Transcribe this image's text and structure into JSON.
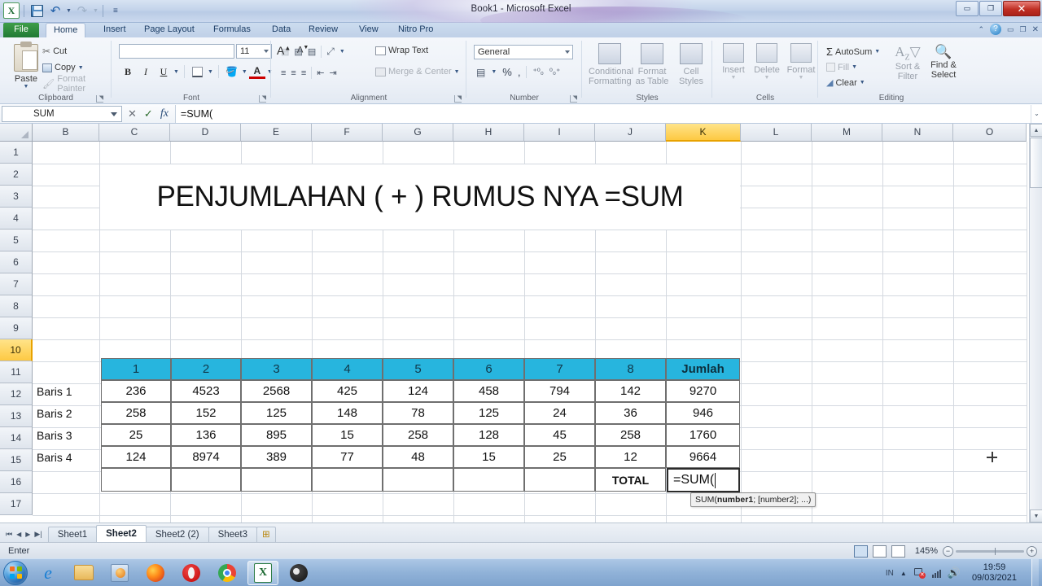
{
  "window": {
    "title": "Book1  -  Microsoft Excel",
    "minimize": "–",
    "maximize": "❐",
    "close": "✕"
  },
  "quick_access": {
    "excel_logo": "X",
    "save_tip": "Save",
    "undo": "↶",
    "redo": "↷",
    "customize": "≡"
  },
  "ribbon": {
    "tabs": [
      {
        "label": "File",
        "active": false,
        "file": true
      },
      {
        "label": "Home",
        "active": true
      },
      {
        "label": "Insert",
        "active": false
      },
      {
        "label": "Page Layout",
        "active": false
      },
      {
        "label": "Formulas",
        "active": false
      },
      {
        "label": "Data",
        "active": false
      },
      {
        "label": "Review",
        "active": false
      },
      {
        "label": "View",
        "active": false
      },
      {
        "label": "Nitro Pro",
        "active": false
      }
    ],
    "help_icons": {
      "minimize_ribbon": "⌃",
      "help": "?",
      "win_min": "–",
      "win_restore": "❐",
      "win_close": "✕"
    },
    "clipboard": {
      "label": "Clipboard",
      "paste": "Paste",
      "cut": "Cut",
      "copy": "Copy",
      "format_painter": "Format Painter"
    },
    "font": {
      "label": "Font",
      "font_name": "",
      "font_name_placeholder": "",
      "font_size": "11",
      "grow_font": "A",
      "shrink_font": "A",
      "bold": "B",
      "italic": "I",
      "underline": "U",
      "borders": "▦",
      "fill_color": "A",
      "font_color": "A"
    },
    "alignment": {
      "label": "Alignment",
      "wrap_text": "Wrap Text",
      "merge_center": "Merge & Center",
      "align_top": "≡",
      "align_middle": "≡",
      "align_bottom": "≡",
      "orientation": "⤨",
      "align_left": "≡",
      "align_center": "≡",
      "align_right": "≡",
      "decrease_indent": "⇤",
      "increase_indent": "⇥"
    },
    "number": {
      "label": "Number",
      "format": "General",
      "accounting": "¤",
      "percent": "%",
      "comma": ",",
      "increase_decimal": ".00",
      "decrease_decimal": ".0"
    },
    "styles": {
      "label": "Styles",
      "conditional_formatting": "Conditional\nFormatting",
      "conditional_formatting_l1": "Conditional",
      "conditional_formatting_l2": "Formatting",
      "format_as_table_l1": "Format",
      "format_as_table_l2": "as Table",
      "cell_styles_l1": "Cell",
      "cell_styles_l2": "Styles"
    },
    "cells": {
      "label": "Cells",
      "insert": "Insert",
      "delete": "Delete",
      "format": "Format"
    },
    "editing": {
      "label": "Editing",
      "autosum": "AutoSum",
      "autosum_sigma": "Σ",
      "fill": "Fill",
      "clear": "Clear",
      "sort_filter_l1": "Sort &",
      "sort_filter_l2": "Filter",
      "find_select_l1": "Find &",
      "find_select_l2": "Select"
    }
  },
  "formula_bar": {
    "name_box": "SUM",
    "cancel": "✕",
    "enter": "✓",
    "insert_function": "fx",
    "formula": "=SUM(",
    "expand": "⌄"
  },
  "grid": {
    "columns": [
      "B",
      "C",
      "D",
      "E",
      "F",
      "G",
      "H",
      "I",
      "J",
      "K",
      "L",
      "M",
      "N",
      "O"
    ],
    "selected_column": "K",
    "rows": [
      "1",
      "2",
      "3",
      "4",
      "5",
      "6",
      "7",
      "8",
      "9",
      "10",
      "11",
      "12",
      "13",
      "14",
      "15",
      "16",
      "17"
    ],
    "selected_row": "10",
    "sheet_title": "PENJUMLAHAN ( + ) RUMUS NYA =SUM",
    "table_header": [
      "1",
      "2",
      "3",
      "4",
      "5",
      "6",
      "7",
      "8",
      "Jumlah"
    ],
    "row_labels": [
      "Baris 1",
      "Baris 2",
      "Baris 3",
      "Baris 4"
    ],
    "data": [
      [
        "236",
        "4523",
        "2568",
        "425",
        "124",
        "458",
        "794",
        "142",
        "9270"
      ],
      [
        "258",
        "152",
        "125",
        "148",
        "78",
        "125",
        "24",
        "36",
        "946"
      ],
      [
        "25",
        "136",
        "895",
        "15",
        "258",
        "128",
        "45",
        "258",
        "1760"
      ],
      [
        "124",
        "8974",
        "389",
        "77",
        "48",
        "15",
        "25",
        "12",
        "9664"
      ]
    ],
    "total_label": "TOTAL",
    "active_cell_value": "=SUM(",
    "tooltip_prefix": "SUM(",
    "tooltip_bold": "number1",
    "tooltip_suffix": "; [number2]; ...)",
    "header_fill": "#27b5de",
    "selection_fill": "#fdc943"
  },
  "sheet_tabs": {
    "first": "⏮",
    "prev": "◀",
    "next": "▶",
    "last": "⏭",
    "tabs": [
      {
        "label": "Sheet1",
        "active": false
      },
      {
        "label": "Sheet2",
        "active": true
      },
      {
        "label": "Sheet2 (2)",
        "active": false
      },
      {
        "label": "Sheet3",
        "active": false
      }
    ],
    "new_sheet": "⊞"
  },
  "status_bar": {
    "mode": "Enter",
    "view_normal": "▦",
    "view_layout": "▤",
    "view_pagebreak": "▥",
    "zoom": "145%",
    "zoom_out": "−",
    "zoom_in": "+"
  },
  "taskbar": {
    "items": [
      {
        "name": "start-orb",
        "label": ""
      },
      {
        "name": "internet-explorer",
        "label": "e"
      },
      {
        "name": "windows-explorer",
        "label": ""
      },
      {
        "name": "media-player",
        "label": ""
      },
      {
        "name": "firefox",
        "label": ""
      },
      {
        "name": "opera",
        "label": "O"
      },
      {
        "name": "chrome",
        "label": ""
      },
      {
        "name": "excel",
        "label": "X"
      },
      {
        "name": "obs-studio",
        "label": ""
      }
    ],
    "tray_language": "IN",
    "time": "19:59",
    "date": "09/03/2021"
  }
}
